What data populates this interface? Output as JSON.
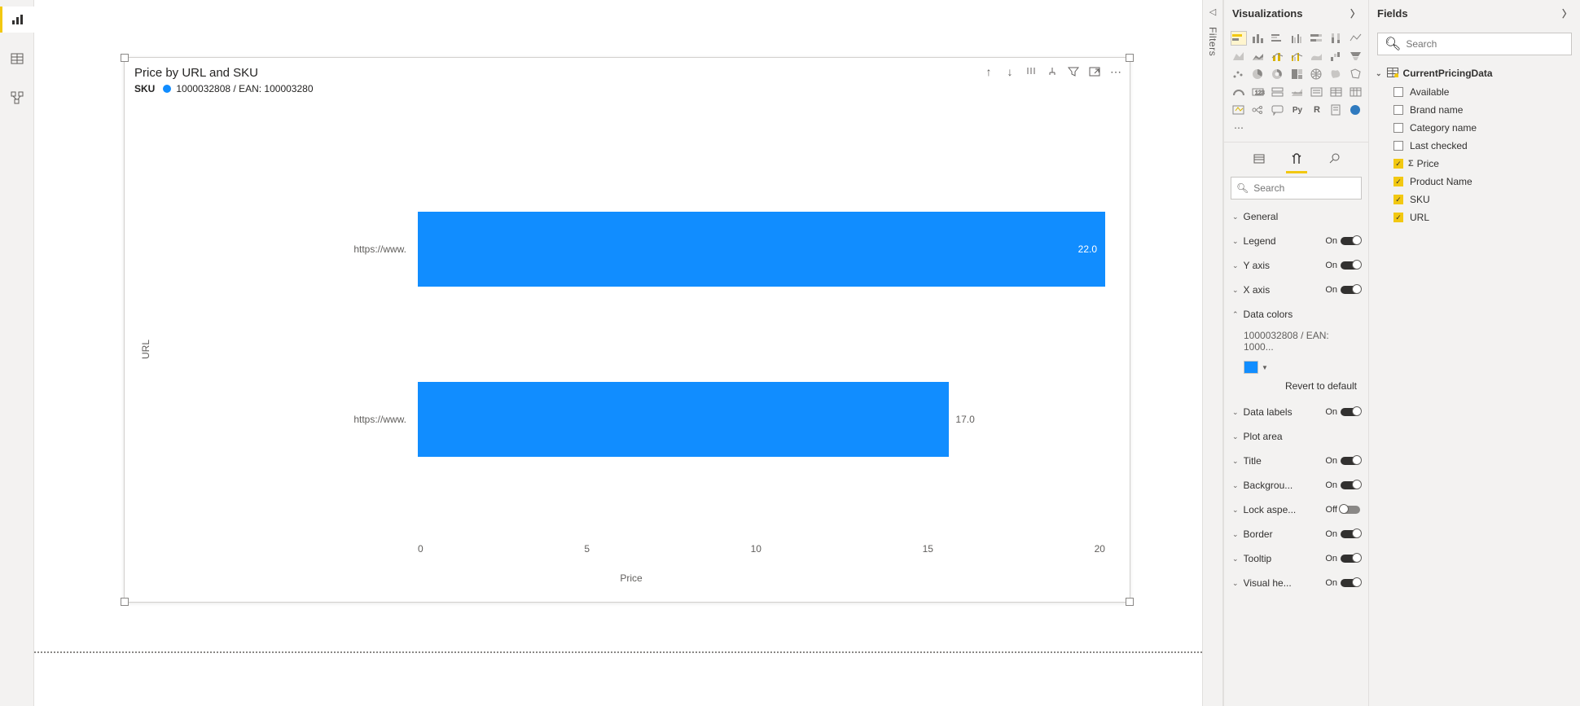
{
  "left_nav": {
    "items": [
      "report-view",
      "data-view",
      "model-view"
    ]
  },
  "visual": {
    "title": "Price by URL and SKU",
    "legend_label": "SKU",
    "legend_item": "1000032808 / EAN: 100003280",
    "y_axis_title": "URL",
    "x_axis_title": "Price"
  },
  "chart_data": {
    "type": "bar",
    "orientation": "horizontal",
    "categories": [
      "https://www.",
      "https://www."
    ],
    "values": [
      22.0,
      17.0
    ],
    "series": [
      {
        "name": "1000032808 / EAN: 100003280",
        "color": "#118DFF"
      }
    ],
    "xlabel": "Price",
    "ylabel": "URL",
    "xlim": [
      0,
      22
    ],
    "x_ticks": [
      0,
      5,
      10,
      15,
      20
    ],
    "data_labels": [
      "22.0",
      "17.0"
    ]
  },
  "filters_pane": {
    "label": "Filters"
  },
  "viz_pane": {
    "title": "Visualizations",
    "search_placeholder": "Search",
    "sections": {
      "general": {
        "label": "General"
      },
      "legend": {
        "label": "Legend",
        "state": "On"
      },
      "yaxis": {
        "label": "Y axis",
        "state": "On"
      },
      "xaxis": {
        "label": "X axis",
        "state": "On"
      },
      "datacolors": {
        "label": "Data colors",
        "item_label": "1000032808 / EAN: 1000...",
        "swatch": "#118DFF",
        "revert": "Revert to default"
      },
      "datalabels": {
        "label": "Data labels",
        "state": "On"
      },
      "plotarea": {
        "label": "Plot area"
      },
      "title": {
        "label": "Title",
        "state": "On"
      },
      "background": {
        "label": "Backgrou...",
        "state": "On"
      },
      "lockaspect": {
        "label": "Lock aspe...",
        "state": "Off"
      },
      "border": {
        "label": "Border",
        "state": "On"
      },
      "tooltip": {
        "label": "Tooltip",
        "state": "On"
      },
      "visualheader": {
        "label": "Visual he...",
        "state": "On"
      }
    }
  },
  "fields_pane": {
    "title": "Fields",
    "search_placeholder": "Search",
    "table": "CurrentPricingData",
    "fields": [
      {
        "name": "Available",
        "checked": false,
        "sigma": false
      },
      {
        "name": "Brand name",
        "checked": false,
        "sigma": false
      },
      {
        "name": "Category name",
        "checked": false,
        "sigma": false
      },
      {
        "name": "Last checked",
        "checked": false,
        "sigma": false
      },
      {
        "name": "Price",
        "checked": true,
        "sigma": true
      },
      {
        "name": "Product Name",
        "checked": true,
        "sigma": false
      },
      {
        "name": "SKU",
        "checked": true,
        "sigma": false
      },
      {
        "name": "URL",
        "checked": true,
        "sigma": false
      }
    ]
  }
}
